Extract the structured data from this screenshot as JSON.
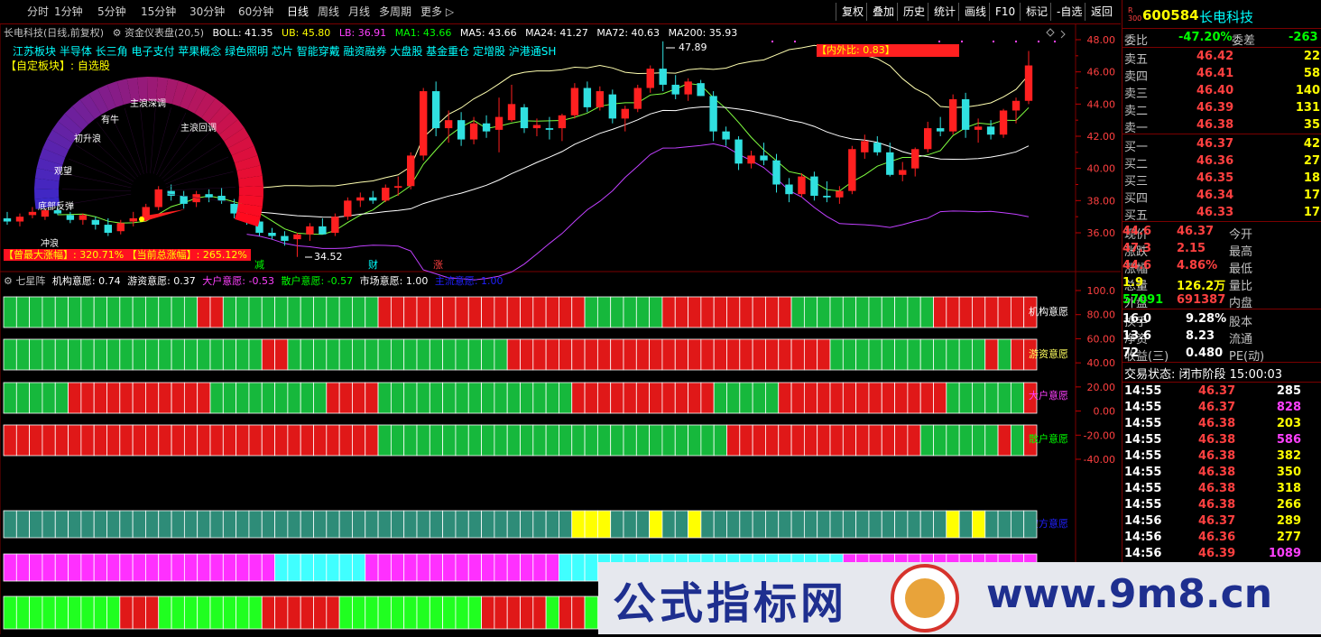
{
  "topbar": {
    "periods": [
      "分时",
      "1分钟",
      "5分钟",
      "15分钟",
      "30分钟",
      "60分钟",
      "日线",
      "周线",
      "月线",
      "多周期",
      "更多"
    ],
    "active_period": "日线",
    "tools": [
      "复权",
      "叠加",
      "历史",
      "统计",
      "画线",
      "F10",
      "标记",
      "-自选",
      "返回"
    ]
  },
  "main": {
    "title": "长电科技(日线,前复权)",
    "indicator_name": "资金仪表盘(20,5)",
    "boll": "BOLL: 41.35",
    "ub": "UB: 45.80",
    "lb": "LB: 36.91",
    "ma1": "MA1: 43.66",
    "ma5": "MA5: 43.66",
    "ma24": "MA24: 41.27",
    "ma72": "MA72: 40.63",
    "ma200": "MA200: 35.93",
    "concepts": "江苏板块 半导体 长三角 电子支付 苹果概念 绿色照明 芯片 智能穿戴 融资融券 大盘股 基金重仓 定增股 沪港通SH",
    "custom_block": "【自定板块】: 自选股",
    "max_gain": "【曾最大涨幅】: 320.71%",
    "cur_gain": "【当前总涨幅】: 265.12%",
    "inout_ratio": "【内外比: 0.83】",
    "high_label": "47.89",
    "low_label": "34.52",
    "events": [
      "减",
      "财",
      "涨"
    ],
    "gauge_labels": [
      "底部反弹",
      "观望",
      "初升浪",
      "有牛",
      "主浪深调",
      "主浪回调",
      "冲浪"
    ],
    "price_ticks": [
      "48.00",
      "46.00",
      "44.00",
      "42.00",
      "40.00",
      "38.00",
      "36.00"
    ]
  },
  "sub": {
    "title": "七星阵",
    "jg": "机构意愿: 0.74",
    "yz": "游资意愿: 0.37",
    "dh": "大户意愿: -0.53",
    "sh": "散户意愿: -0.57",
    "sc": "市场意愿: 1.00",
    "zl": "主流意愿: 1.00",
    "row_labels": [
      "机构意愿",
      "游资意愿",
      "大户意愿",
      "散户意愿",
      "空方意愿"
    ],
    "ticks": [
      "100.0",
      "80.00",
      "60.00",
      "40.00",
      "20.00",
      "0.00",
      "-20.00",
      "-40.00"
    ]
  },
  "quote": {
    "badge": "R 300",
    "code": "600584",
    "name": "长电科技",
    "weibi_label": "委比",
    "weibi_value": "-47.20%",
    "weicha_label": "委差",
    "weicha_value": "-263",
    "asks": [
      {
        "label": "卖五",
        "price": "46.42",
        "vol": "22"
      },
      {
        "label": "卖四",
        "price": "46.41",
        "vol": "58"
      },
      {
        "label": "卖三",
        "price": "46.40",
        "vol": "140"
      },
      {
        "label": "卖二",
        "price": "46.39",
        "vol": "131"
      },
      {
        "label": "卖一",
        "price": "46.38",
        "vol": "35"
      }
    ],
    "bids": [
      {
        "label": "买一",
        "price": "46.37",
        "vol": "42"
      },
      {
        "label": "买二",
        "price": "46.36",
        "vol": "27"
      },
      {
        "label": "买三",
        "price": "46.35",
        "vol": "18"
      },
      {
        "label": "买四",
        "price": "46.34",
        "vol": "17"
      },
      {
        "label": "买五",
        "price": "46.33",
        "vol": "17"
      }
    ],
    "stats": [
      {
        "l1": "现价",
        "v1": "46.37",
        "l2": "今开",
        "v2": "44.6"
      },
      {
        "l1": "涨跌",
        "v1": "2.15",
        "l2": "最高",
        "v2": "47.3"
      },
      {
        "l1": "涨幅",
        "v1": "4.86%",
        "l2": "最低",
        "v2": "44.6"
      },
      {
        "l1": "总量",
        "v1": "126.2万",
        "l2": "量比",
        "v2": "1.9"
      },
      {
        "l1": "外盘",
        "v1": "691387",
        "l2": "内盘",
        "v2": "57091"
      }
    ],
    "stats2": [
      {
        "l1": "换手",
        "v1": "9.28%",
        "l2": "股本",
        "v2": "16.0"
      },
      {
        "l1": "净资",
        "v1": "8.23",
        "l2": "流通",
        "v2": "13.6"
      },
      {
        "l1": "收益(三)",
        "v1": "0.480",
        "l2": "PE(动)",
        "v2": "72"
      }
    ],
    "trade_status": "交易状态: 闭市阶段 15:00:03",
    "ticks": [
      {
        "t": "14:55",
        "p": "46.37",
        "v": "285",
        "c": "#ffffff"
      },
      {
        "t": "14:55",
        "p": "46.37",
        "v": "828",
        "c": "#ff40ff"
      },
      {
        "t": "14:55",
        "p": "46.38",
        "v": "203",
        "c": "#ffff00"
      },
      {
        "t": "14:55",
        "p": "46.38",
        "v": "586",
        "c": "#ff40ff"
      },
      {
        "t": "14:55",
        "p": "46.38",
        "v": "382",
        "c": "#ffff00"
      },
      {
        "t": "14:55",
        "p": "46.38",
        "v": "350",
        "c": "#ffff00"
      },
      {
        "t": "14:55",
        "p": "46.38",
        "v": "318",
        "c": "#ffff00"
      },
      {
        "t": "14:55",
        "p": "46.38",
        "v": "266",
        "c": "#ffff00"
      },
      {
        "t": "14:56",
        "p": "46.37",
        "v": "289",
        "c": "#ffff00"
      },
      {
        "t": "14:56",
        "p": "46.36",
        "v": "277",
        "c": "#ffff00"
      },
      {
        "t": "14:56",
        "p": "46.39",
        "v": "1089",
        "c": "#ff40ff"
      }
    ]
  },
  "watermark": {
    "cn": "公式指标网",
    "en": "www.9m8.cn"
  }
}
